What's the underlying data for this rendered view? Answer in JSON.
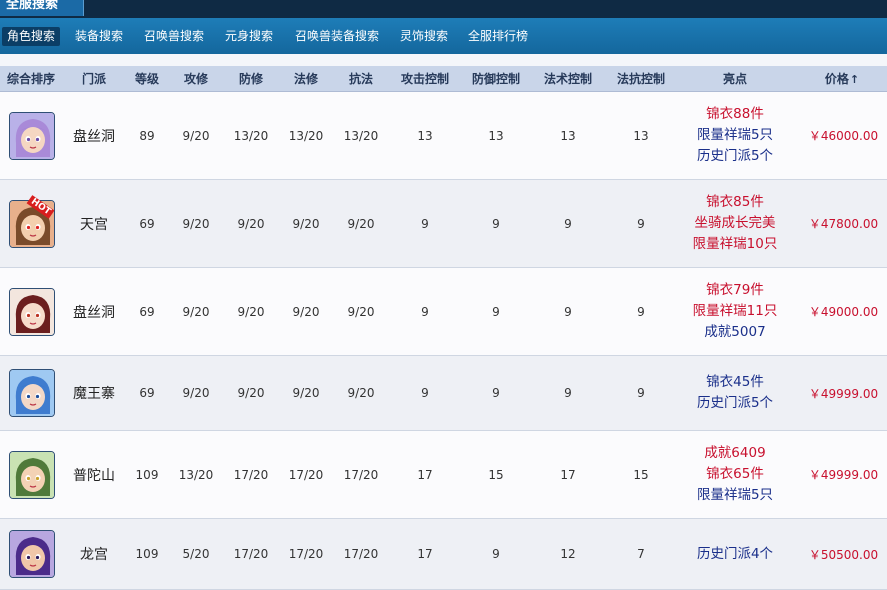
{
  "top_tab": {
    "label": "全服搜索"
  },
  "nav": {
    "items": [
      {
        "label": "角色搜索",
        "active": true
      },
      {
        "label": "装备搜索"
      },
      {
        "label": "召唤兽搜索"
      },
      {
        "label": "元身搜索"
      },
      {
        "label": "召唤兽装备搜索"
      },
      {
        "label": "灵饰搜索"
      },
      {
        "label": "全服排行榜"
      }
    ]
  },
  "table": {
    "headers": {
      "rank": "综合排序",
      "school": "门派",
      "level": "等级",
      "atk": "攻修",
      "def": "防修",
      "mag": "法修",
      "res": "抗法",
      "atk_ctrl": "攻击控制",
      "def_ctrl": "防御控制",
      "mag_ctrl": "法术控制",
      "res_ctrl": "法抗控制",
      "highlights": "亮点",
      "price": "价格",
      "price_sort_icon": "↑"
    },
    "rows": [
      {
        "avatar": "avatar-purple-hair",
        "school": "盘丝洞",
        "level": "89",
        "atk": "9/20",
        "def": "13/20",
        "mag": "13/20",
        "res": "13/20",
        "atk_ctrl": "13",
        "def_ctrl": "13",
        "mag_ctrl": "13",
        "res_ctrl": "13",
        "highlights": [
          {
            "text": "锦衣88件",
            "color": "red"
          },
          {
            "text": "限量祥瑞5只",
            "color": "blue"
          },
          {
            "text": "历史门派5个",
            "color": "blue"
          }
        ],
        "price": "￥46000.00"
      },
      {
        "avatar": "avatar-hot-badge",
        "school": "天宫",
        "level": "69",
        "atk": "9/20",
        "def": "9/20",
        "mag": "9/20",
        "res": "9/20",
        "atk_ctrl": "9",
        "def_ctrl": "9",
        "mag_ctrl": "9",
        "res_ctrl": "9",
        "highlights": [
          {
            "text": "锦衣85件",
            "color": "red"
          },
          {
            "text": "坐骑成长完美",
            "color": "red"
          },
          {
            "text": "限量祥瑞10只",
            "color": "red"
          }
        ],
        "price": "￥47800.00",
        "badge": "HOT"
      },
      {
        "avatar": "avatar-red-hair",
        "school": "盘丝洞",
        "level": "69",
        "atk": "9/20",
        "def": "9/20",
        "mag": "9/20",
        "res": "9/20",
        "atk_ctrl": "9",
        "def_ctrl": "9",
        "mag_ctrl": "9",
        "res_ctrl": "9",
        "highlights": [
          {
            "text": "锦衣79件",
            "color": "red"
          },
          {
            "text": "限量祥瑞11只",
            "color": "red"
          },
          {
            "text": "成就5007",
            "color": "blue"
          }
        ],
        "price": "￥49000.00"
      },
      {
        "avatar": "avatar-blue-hair",
        "school": "魔王寨",
        "level": "69",
        "atk": "9/20",
        "def": "9/20",
        "mag": "9/20",
        "res": "9/20",
        "atk_ctrl": "9",
        "def_ctrl": "9",
        "mag_ctrl": "9",
        "res_ctrl": "9",
        "highlights": [
          {
            "text": "锦衣45件",
            "color": "blue"
          },
          {
            "text": "历史门派5个",
            "color": "blue"
          }
        ],
        "price": "￥49999.00"
      },
      {
        "avatar": "avatar-green-crown",
        "school": "普陀山",
        "level": "109",
        "atk": "13/20",
        "def": "17/20",
        "mag": "17/20",
        "res": "17/20",
        "atk_ctrl": "17",
        "def_ctrl": "15",
        "mag_ctrl": "17",
        "res_ctrl": "15",
        "highlights": [
          {
            "text": "成就6409",
            "color": "red"
          },
          {
            "text": "锦衣65件",
            "color": "red"
          },
          {
            "text": "限量祥瑞5只",
            "color": "blue"
          }
        ],
        "price": "￥49999.00"
      },
      {
        "avatar": "avatar-purple-warrior",
        "school": "龙宫",
        "level": "109",
        "atk": "5/20",
        "def": "17/20",
        "mag": "17/20",
        "res": "17/20",
        "atk_ctrl": "17",
        "def_ctrl": "9",
        "mag_ctrl": "12",
        "res_ctrl": "7",
        "highlights": [
          {
            "text": "历史门派4个",
            "color": "blue"
          }
        ],
        "price": "￥50500.00"
      }
    ]
  },
  "colors": {
    "nav_bg": "#1a74ad",
    "header_bg": "#c9d5e9",
    "price": "#c8102e",
    "highlight_red": "#c8102e",
    "highlight_blue": "#1a2f8a"
  }
}
